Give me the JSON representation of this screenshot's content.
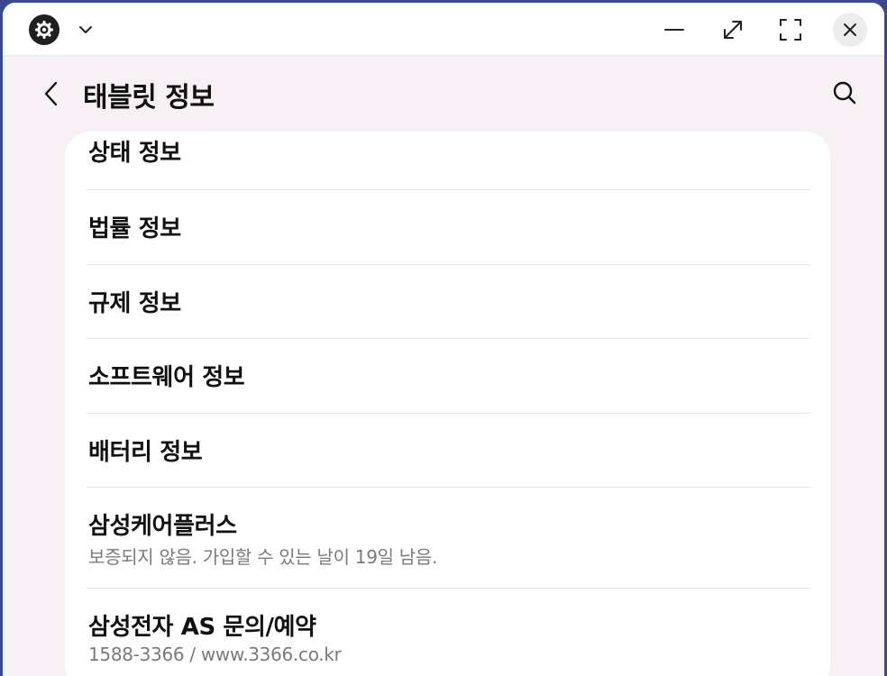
{
  "header": {
    "title": "태블릿 정보"
  },
  "icons": {
    "app": "settings-gear-icon",
    "dropdown": "chevron-down-icon",
    "minimize": "minimize-icon",
    "restore": "resize-diagonal-icon",
    "fullscreen": "fullscreen-icon",
    "close": "close-icon",
    "back": "chevron-left-icon",
    "search": "search-icon"
  },
  "list": {
    "items": [
      {
        "label": "상태 정보"
      },
      {
        "label": "법률 정보"
      },
      {
        "label": "규제 정보"
      },
      {
        "label": "소프트웨어 정보"
      },
      {
        "label": "배터리 정보"
      },
      {
        "label": "삼성케어플러스",
        "sub": "보증되지 않음. 가입할 수 있는 날이 19일 남음."
      },
      {
        "label": "삼성전자 AS 문의/예약",
        "sub": "1588-3366 / www.3366.co.kr"
      }
    ]
  },
  "colors": {
    "background": "#f7f1f5",
    "card": "#ffffff",
    "text": "#111111",
    "subtext": "#7a7a7a"
  }
}
